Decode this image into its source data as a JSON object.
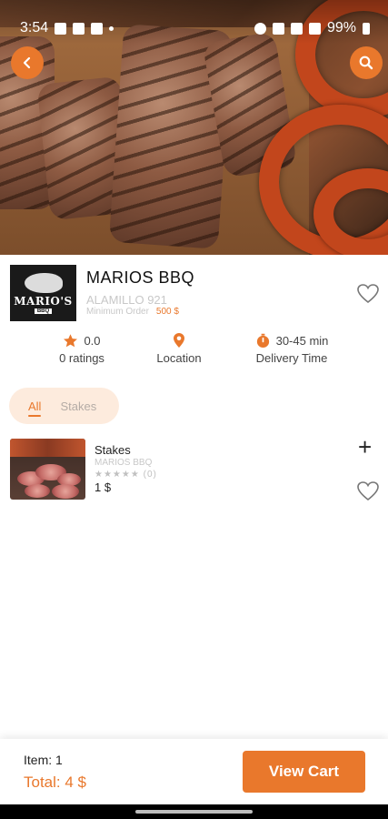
{
  "status_bar": {
    "time": "3:54",
    "battery": "99%"
  },
  "header": {
    "back_icon": "chevron-left-icon",
    "search_icon": "search-icon"
  },
  "restaurant": {
    "logo_text": "MARIO'S",
    "logo_subtext": "BBQ",
    "name": "MARIOS BBQ",
    "address": "ALAMILLO 921",
    "min_order_label": "Minimum Order",
    "min_order_value": "500 $",
    "rating_value": "0.0",
    "rating_label": "0 ratings",
    "location_label": "Location",
    "delivery_value": "30-45 min",
    "delivery_label": "Delivery Time"
  },
  "categories": [
    {
      "label": "All",
      "selected": true
    },
    {
      "label": "Stakes",
      "selected": false
    }
  ],
  "products": [
    {
      "name": "Stakes",
      "restaurant": "MARIOS BBQ",
      "stars": "★★★★★",
      "rating_count": "(0)",
      "price": "1 $",
      "add_label": "+"
    }
  ],
  "cart": {
    "item_label": "Item: 1",
    "total_label": "Total: 4 $",
    "button_label": "View Cart"
  },
  "colors": {
    "accent": "#e9782c",
    "chip_bg": "#fdebdd",
    "muted": "#c8c8c8"
  }
}
